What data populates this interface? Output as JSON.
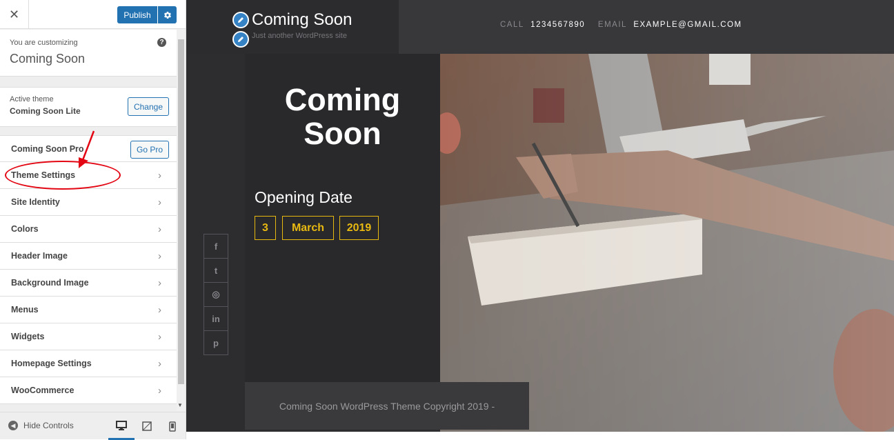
{
  "customizer": {
    "close_label": "✕",
    "publish_label": "Publish",
    "customizing_label": "You are customizing",
    "customizing_title": "Coming Soon",
    "help_label": "?",
    "active_theme_label": "Active theme",
    "active_theme_name": "Coming Soon Lite",
    "change_label": "Change",
    "pro_section_label": "Coming Soon Pro",
    "gopro_label": "Go Pro",
    "sections": [
      {
        "label": "Theme Settings"
      },
      {
        "label": "Site Identity"
      },
      {
        "label": "Colors"
      },
      {
        "label": "Header Image"
      },
      {
        "label": "Background Image"
      },
      {
        "label": "Menus"
      },
      {
        "label": "Widgets"
      },
      {
        "label": "Homepage Settings"
      },
      {
        "label": "WooCommerce"
      }
    ],
    "chevron": "›",
    "hide_controls_label": "Hide Controls",
    "accent_color": "#2271b1",
    "highlight_color": "#e30613"
  },
  "preview": {
    "site_title": "Coming Soon",
    "site_tagline": "Just another WordPress site",
    "call_label": "CALL",
    "call_value": "1234567890",
    "email_label": "EMAIL",
    "email_value": "EXAMPLE@GMAIL.COM",
    "main_title_line1": "Coming",
    "main_title_line2": "Soon",
    "opening_label": "Opening Date",
    "date_day": "3",
    "date_month": "March",
    "date_year": "2019",
    "date_color": "#e8b911",
    "social": [
      {
        "icon": "facebook-icon",
        "glyph": "f"
      },
      {
        "icon": "twitter-icon",
        "glyph": "t"
      },
      {
        "icon": "instagram-icon",
        "glyph": "◎"
      },
      {
        "icon": "linkedin-icon",
        "glyph": "in"
      },
      {
        "icon": "pinterest-icon",
        "glyph": "p"
      }
    ],
    "copyright": "Coming Soon WordPress Theme Copyright 2019 -"
  }
}
